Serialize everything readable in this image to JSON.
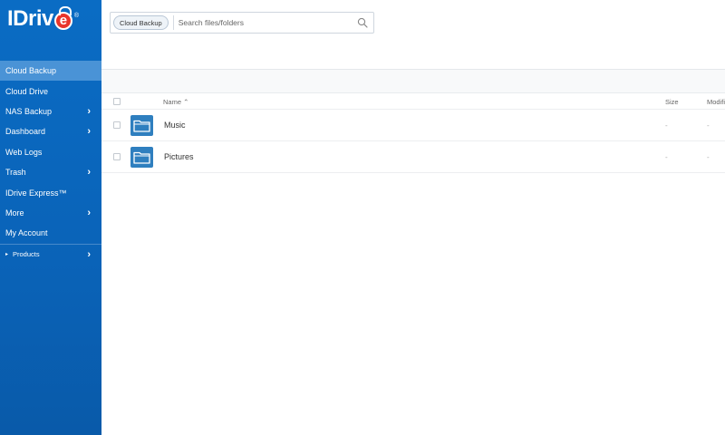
{
  "brand": {
    "name": "IDriv",
    "e_glyph": "e",
    "reg": "®"
  },
  "sidebar": {
    "items": [
      {
        "label": "Cloud Backup",
        "active": true,
        "chevron": ""
      },
      {
        "label": "Cloud Drive",
        "active": false,
        "chevron": ""
      },
      {
        "label": "NAS Backup",
        "active": false,
        "chevron": "›"
      },
      {
        "label": "Dashboard",
        "active": false,
        "chevron": "›"
      },
      {
        "label": "Web Logs",
        "active": false,
        "chevron": ""
      },
      {
        "label": "Trash",
        "active": false,
        "chevron": "›"
      },
      {
        "label": "IDrive Express™",
        "active": false,
        "chevron": ""
      },
      {
        "label": "More",
        "active": false,
        "chevron": "›"
      },
      {
        "label": "My Account",
        "active": false,
        "chevron": ""
      }
    ],
    "products": {
      "caret": "▸",
      "label": "Products",
      "chevron": "›"
    }
  },
  "search": {
    "scope": "Cloud Backup",
    "placeholder": "Search files/folders",
    "value": ""
  },
  "table": {
    "columns": {
      "name": "Name ⌃",
      "size": "Size",
      "modified": "Modifi"
    },
    "rows": [
      {
        "name": "Music",
        "size": "-",
        "modified": "-"
      },
      {
        "name": "Pictures",
        "size": "-",
        "modified": "-"
      }
    ]
  },
  "colors": {
    "sidebar": "#0a6cc4",
    "active": "#4a93d6",
    "folder": "#2f7fbf",
    "logo_e": "#e8352b"
  }
}
